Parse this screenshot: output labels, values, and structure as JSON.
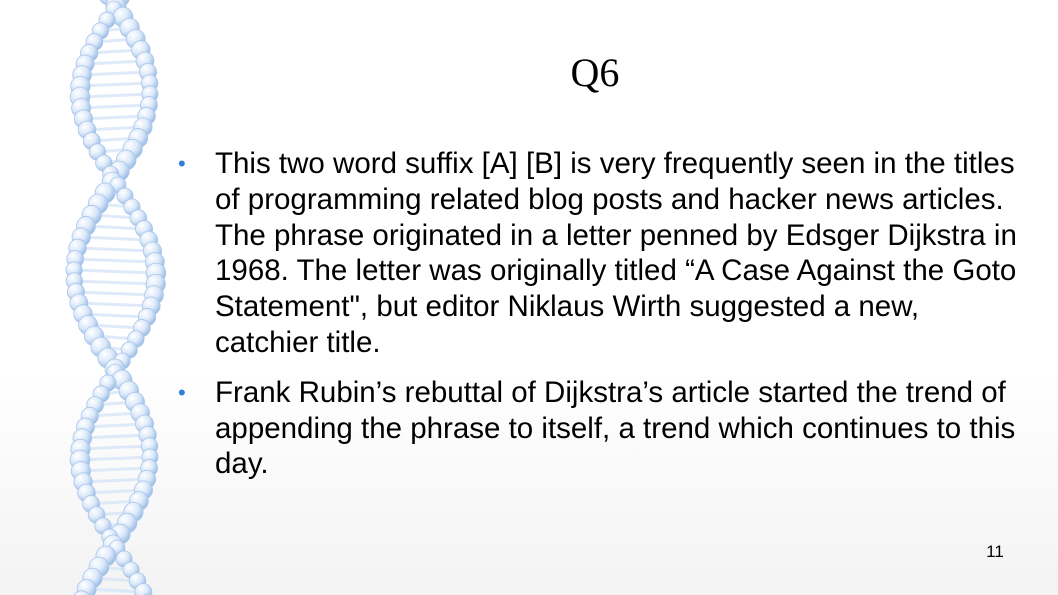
{
  "slide": {
    "title": "Q6",
    "bullet_marker": "•",
    "bullets": [
      "This two word suffix [A] [B] is very frequently seen in the titles of programming related blog posts and hacker news articles. The phrase originated in a letter penned by Edsger Dijkstra in 1968. The letter was originally titled “A Case Against the Goto Statement\", but editor Niklaus Wirth suggested a new, catchier title.",
      "Frank Rubin’s rebuttal of Dijkstra’s article started the trend of appending the phrase to itself, a trend which continues to this day."
    ],
    "page_number": "11"
  },
  "decoration": {
    "name": "dna-helix-icon",
    "sphere_color": "#cfe0f7",
    "bond_color": "#d9e7f8"
  }
}
